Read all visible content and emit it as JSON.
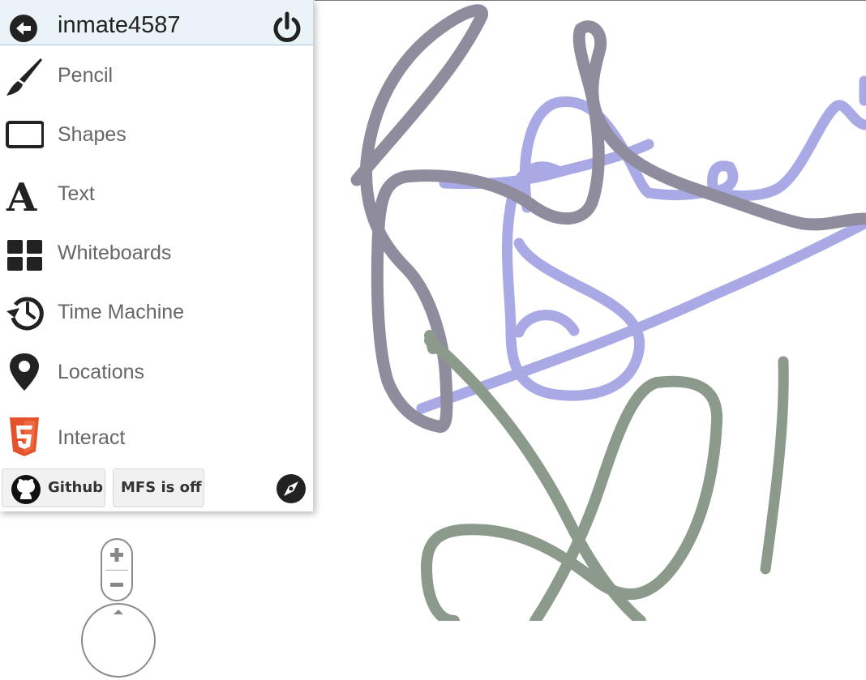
{
  "user": {
    "name": "inmate4587",
    "back_icon": "back-arrow-circle-icon",
    "power_icon": "power-icon"
  },
  "menu": [
    {
      "label": "Pencil",
      "icon": "pencil-brush-icon"
    },
    {
      "label": "Shapes",
      "icon": "rectangle-icon"
    },
    {
      "label": "Text",
      "icon": "text-A-icon"
    },
    {
      "label": "Whiteboards",
      "icon": "grid-icon"
    },
    {
      "label": "Time Machine",
      "icon": "history-icon"
    },
    {
      "label": "Locations",
      "icon": "map-pin-icon"
    },
    {
      "label": "Interact",
      "icon": "html5-icon"
    }
  ],
  "footer": {
    "github_label": "Github",
    "mfs_label": "MFS is off",
    "compass_icon": "compass-icon"
  },
  "zoom": {
    "in_icon": "plus-icon",
    "out_icon": "minus-icon"
  },
  "colors": {
    "stroke_gray": "#8f8c9e",
    "stroke_lavender": "#a9a9e6",
    "stroke_green": "#8c9a8c",
    "html5_orange": "#e5532d",
    "user_bar_bg": "#e9f3f8"
  }
}
